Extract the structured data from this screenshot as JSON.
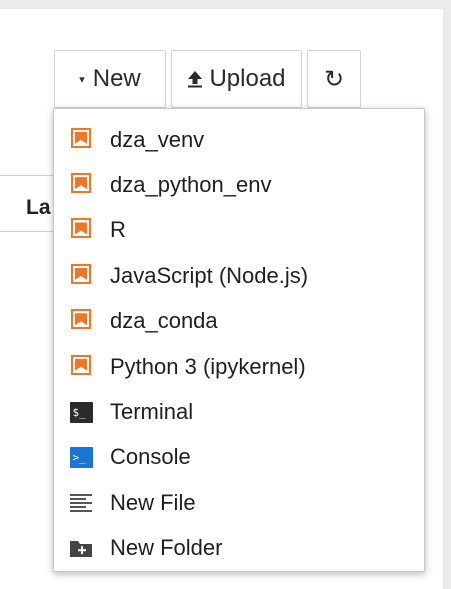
{
  "toolbar": {
    "new_label": "New",
    "new_caret": "▾",
    "upload_label": "Upload",
    "refresh_glyph": "↻"
  },
  "listing": {
    "header_partial": "La"
  },
  "new_menu": {
    "items": [
      {
        "label": "dza_venv",
        "icon": "kernel-bookmark-icon"
      },
      {
        "label": "dza_python_env",
        "icon": "kernel-bookmark-icon"
      },
      {
        "label": "R",
        "icon": "kernel-bookmark-icon"
      },
      {
        "label": "JavaScript (Node.js)",
        "icon": "kernel-bookmark-icon"
      },
      {
        "label": "dza_conda",
        "icon": "kernel-bookmark-icon"
      },
      {
        "label": "Python 3 (ipykernel)",
        "icon": "kernel-bookmark-icon"
      },
      {
        "label": "Terminal",
        "icon": "terminal-icon"
      },
      {
        "label": "Console",
        "icon": "console-icon"
      },
      {
        "label": "New File",
        "icon": "text-file-icon"
      },
      {
        "label": "New Folder",
        "icon": "new-folder-icon"
      }
    ],
    "terminal_glyph": "$_",
    "console_glyph": ">_"
  },
  "colors": {
    "kernel_orange": "#f37626",
    "console_blue": "#1976d2",
    "terminal_dark": "#2b2b2b"
  }
}
